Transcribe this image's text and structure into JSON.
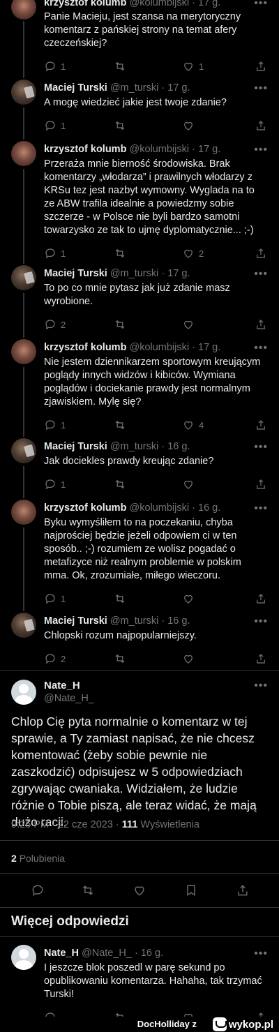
{
  "thread": [
    {
      "author": "krzysztof kolumb",
      "handle": "@kolumbijski",
      "time": "17 g.",
      "text": "Panie Macieju, jest szansa na merytoryczny komentarz z pańskiej strony na temat afery czeczeńskiej?",
      "replies": "1",
      "retweets": "",
      "likes": "1"
    },
    {
      "author": "Maciej Turski",
      "handle": "@m_turski",
      "time": "17 g.",
      "text": "A mogę wiedzieć jakie jest twoje zdanie?",
      "replies": "1",
      "retweets": "",
      "likes": ""
    },
    {
      "author": "krzysztof kolumb",
      "handle": "@kolumbijski",
      "time": "17 g.",
      "text": "Przeraża mnie bierność środowiska. Brak komentarzy „włodarza” i prawilnych włodarzy z KRSu tez jest nazbyt wymowny. Wyglada na to ze ABW trafila idealnie a powiedzmy sobie szczerze - w Polsce nie byli bardzo samotni towarzysko ze tak to ujmę dyplomatycznie... ;-)",
      "replies": "1",
      "retweets": "",
      "likes": "2"
    },
    {
      "author": "Maciej Turski",
      "handle": "@m_turski",
      "time": "17 g.",
      "text": "To po co mnie pytasz jak już zdanie masz wyrobione.",
      "replies": "2",
      "retweets": "",
      "likes": ""
    },
    {
      "author": "krzysztof kolumb",
      "handle": "@kolumbijski",
      "time": "17 g.",
      "text": "Nie jestem dziennikarzem sportowym kreującym poglądy innych widzów i kibiców. Wymiana poglądów i dociekanie prawdy jest normalnym zjawiskiem. Mylę się?",
      "replies": "1",
      "retweets": "",
      "likes": "4"
    },
    {
      "author": "Maciej Turski",
      "handle": "@m_turski",
      "time": "16 g.",
      "text": "Jak dociekles prawdy kreując zdanie?",
      "replies": "1",
      "retweets": "",
      "likes": ""
    },
    {
      "author": "krzysztof kolumb",
      "handle": "@kolumbijski",
      "time": "16 g.",
      "text": "Byku wymyśliłem to na poczekaniu, chyba najprościej będzie jeżeli odpowiem ci w ten sposób.. ;-) rozumiem ze wolisz pogadać o metafizyce niż realnym problemie w polskim mma. Ok, zrozumiałe, miłego wieczoru.",
      "replies": "1",
      "retweets": "",
      "likes": ""
    },
    {
      "author": "Maciej Turski",
      "handle": "@m_turski",
      "time": "16 g.",
      "text": "Chlopski rozum najpopularniejszy.",
      "replies": "2",
      "retweets": "",
      "likes": ""
    }
  ],
  "main": {
    "author": "Nate_H",
    "handle": "@Nate_H_",
    "text": "Chlop Cię pyta normalnie o komentarz w tej sprawie, a Ty zamiast napisać, że nie chcesz komentować (żeby sobie pewnie nie zaszkodzić) odpisujesz w 5 odpowiedziach zgrywając cwaniaka. Widziałem, że ludzie różnie o Tobie piszą, ale teraz widać, że mają dużo racji.",
    "time": "9:26 PM",
    "date": "22 cze 2023",
    "views_count": "111",
    "views_label": "Wyświetlenia",
    "likes_count": "2",
    "likes_label": "Polubienia"
  },
  "more_replies_title": "Więcej odpowiedzi",
  "reply": {
    "author": "Nate_H",
    "handle": "@Nate_H_",
    "time": "16 g.",
    "text": "I jeszcze blok poszedl w parę sekund po opublikowaniu komentarza. Hahaha, tak trzymać Turski!",
    "replies": "",
    "retweets": "",
    "likes": ""
  },
  "footer": {
    "credit": "DocHolliday",
    "prefix": "z",
    "site": "wykop.pl"
  },
  "icons": {
    "reply": "reply-icon",
    "retweet": "retweet-icon",
    "like": "heart-icon",
    "share": "share-icon",
    "bookmark": "bookmark-icon",
    "more": "more-icon"
  },
  "colors": {
    "background": "#000000",
    "text": "#e7e9ea",
    "muted": "#71767b",
    "divider": "#2f3336"
  }
}
